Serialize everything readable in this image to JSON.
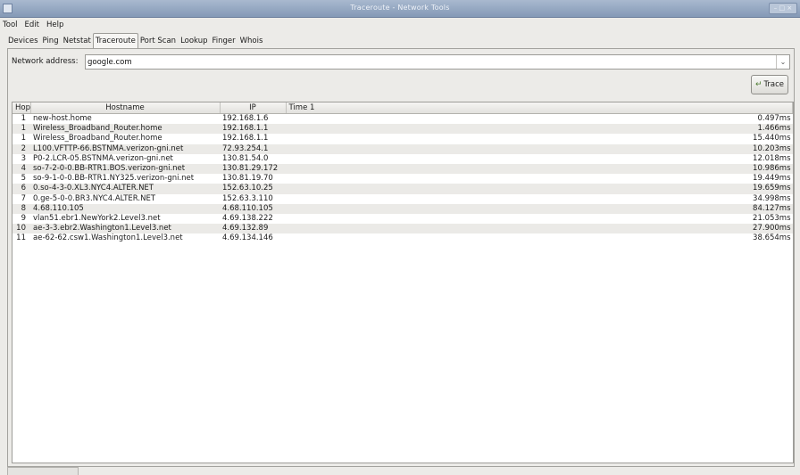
{
  "window": {
    "title": "Traceroute - Network Tools",
    "controls": "– □ ×"
  },
  "menubar": [
    "Tool",
    "Edit",
    "Help"
  ],
  "tabs": [
    "Devices",
    "Ping",
    "Netstat",
    "Traceroute",
    "Port Scan",
    "Lookup",
    "Finger",
    "Whois"
  ],
  "active_tab": "Traceroute",
  "address": {
    "label": "Network address:",
    "value": "google.com"
  },
  "trace_button": {
    "label": "Trace",
    "icon": "trace-icon"
  },
  "table": {
    "columns": [
      "Hop",
      "Hostname",
      "IP",
      "Time 1"
    ],
    "rows": [
      [
        "1",
        "new-host.home",
        "192.168.1.6",
        "0.497ms"
      ],
      [
        "1",
        "Wireless_Broadband_Router.home",
        "192.168.1.1",
        "1.466ms"
      ],
      [
        "1",
        "Wireless_Broadband_Router.home",
        "192.168.1.1",
        "15.440ms"
      ],
      [
        "2",
        "L100.VFTTP-66.BSTNMA.verizon-gni.net",
        "72.93.254.1",
        "10.203ms"
      ],
      [
        "3",
        "P0-2.LCR-05.BSTNMA.verizon-gni.net",
        "130.81.54.0",
        "12.018ms"
      ],
      [
        "4",
        "so-7-2-0-0.BB-RTR1.BOS.verizon-gni.net",
        "130.81.29.172",
        "10.986ms"
      ],
      [
        "5",
        "so-9-1-0-0.BB-RTR1.NY325.verizon-gni.net",
        "130.81.19.70",
        "19.449ms"
      ],
      [
        "6",
        "0.so-4-3-0.XL3.NYC4.ALTER.NET",
        "152.63.10.25",
        "19.659ms"
      ],
      [
        "7",
        "0.ge-5-0-0.BR3.NYC4.ALTER.NET",
        "152.63.3.110",
        "34.998ms"
      ],
      [
        "8",
        "4.68.110.105",
        "4.68.110.105",
        "84.127ms"
      ],
      [
        "9",
        "vlan51.ebr1.NewYork2.Level3.net",
        "4.69.138.222",
        "21.053ms"
      ],
      [
        "10",
        "ae-3-3.ebr2.Washington1.Level3.net",
        "4.69.132.89",
        "27.900ms"
      ],
      [
        "11",
        "ae-62-62.csw1.Washington1.Level3.net",
        "4.69.134.146",
        "38.654ms"
      ]
    ]
  }
}
